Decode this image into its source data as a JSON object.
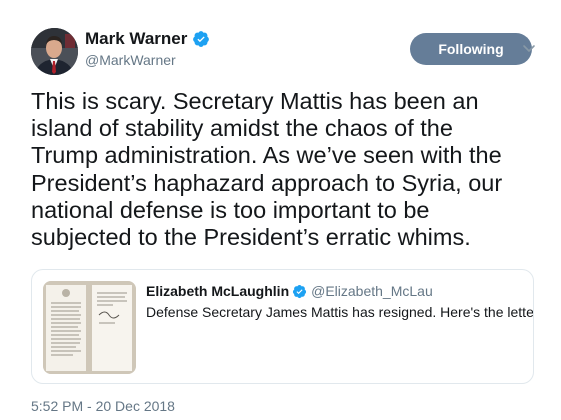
{
  "author": {
    "name": "Mark Warner",
    "handle": "@MarkWarner",
    "verified": true,
    "follow_label": "Following"
  },
  "tweet": {
    "lines": [
      "This is scary. Secretary Mattis has been an",
      "island of stability amidst the chaos of the",
      "Trump administration. As we’ve seen with the",
      "President’s haphazard approach to Syria, our",
      "national defense is too important to be",
      "subjected to the President’s erratic whims."
    ]
  },
  "quoted": {
    "name": "Elizabeth McLaughlin",
    "handle": "@Elizabeth_McLau",
    "verified": true,
    "text": "Defense Secretary James Mattis has resigned. Here's the letter:"
  },
  "timestamp": "5:52 PM - 20 Dec 2018",
  "colors": {
    "follow_button": "#657d98",
    "verified_badge": "#1da1f2",
    "secondary_text": "#657786"
  },
  "icons": {
    "verified": "verified-badge-icon",
    "menu": "chevron-down-icon"
  }
}
